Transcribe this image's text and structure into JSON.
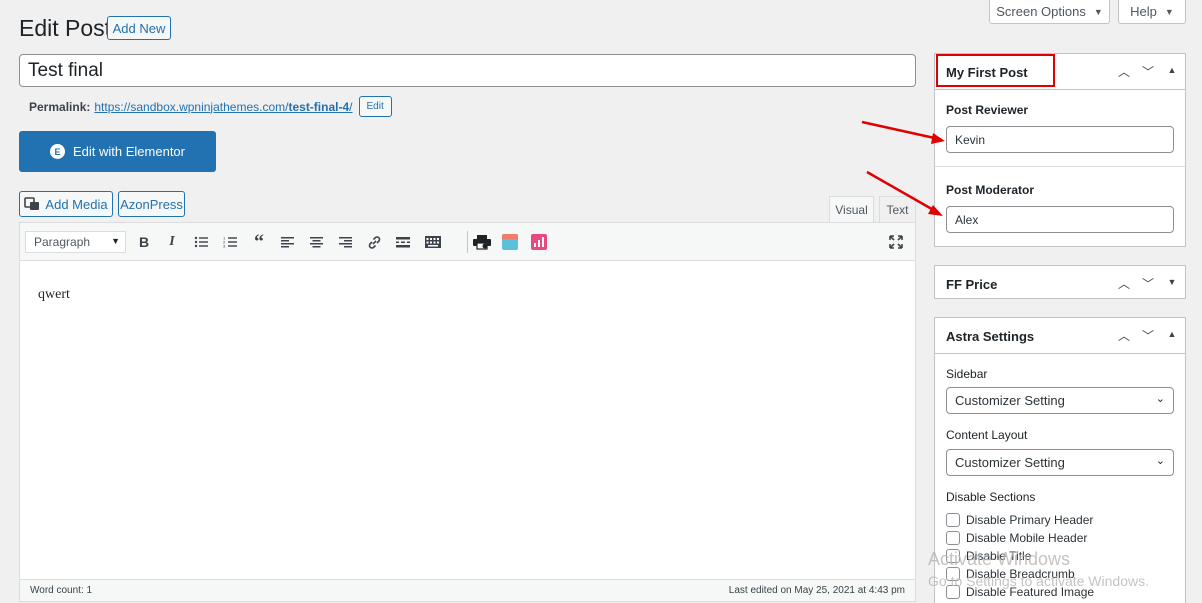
{
  "header": {
    "screen_options": "Screen Options",
    "help": "Help",
    "page_title": "Edit Post",
    "add_new": "Add New"
  },
  "post": {
    "title": "Test final",
    "permalink_label": "Permalink:",
    "permalink_base": "https://sandbox.wpninjathemes.com/",
    "permalink_slug": "test-final-4",
    "permalink_trail": "/",
    "permalink_edit": "Edit"
  },
  "elementor": {
    "label": "Edit with Elementor",
    "icon": "elementor-icon"
  },
  "media": {
    "add_media": "Add Media",
    "azonpress": "AzonPress"
  },
  "editor": {
    "tab_visual": "Visual",
    "tab_text": "Text",
    "format": "Paragraph",
    "toolbar_icons": [
      "bold-icon",
      "italic-icon",
      "bullet-list-icon",
      "numbered-list-icon",
      "blockquote-icon",
      "align-left-icon",
      "align-center-icon",
      "align-right-icon",
      "link-icon",
      "read-more-icon",
      "toolbar-toggle-icon",
      "printer-icon",
      "table-icon",
      "chart-icon",
      "fullscreen-icon"
    ],
    "content": "qwert",
    "word_count": "Word count: 1",
    "last_edited": "Last edited on May 25, 2021 at 4:43 pm"
  },
  "sidebar": {
    "first_post": {
      "title": "My First Post",
      "reviewer_label": "Post Reviewer",
      "reviewer_value": "Kevin",
      "moderator_label": "Post Moderator",
      "moderator_value": "Alex"
    },
    "ff_price": {
      "title": "FF Price"
    },
    "astra": {
      "title": "Astra Settings",
      "sidebar_label": "Sidebar",
      "sidebar_value": "Customizer Setting",
      "layout_label": "Content Layout",
      "layout_value": "Customizer Setting",
      "disable_label": "Disable Sections",
      "checks": [
        "Disable Primary Header",
        "Disable Mobile Header",
        "Disable Title",
        "Disable Breadcrumb",
        "Disable Featured Image"
      ]
    }
  },
  "annotation": {
    "highlight_color": "#e00000",
    "arrow_color": "#e00000"
  },
  "watermark": {
    "line1": "Activate Windows",
    "line2": "Go to Settings to activate Windows."
  },
  "colors": {
    "accent": "#2271b1",
    "background": "#f0f0f1"
  }
}
